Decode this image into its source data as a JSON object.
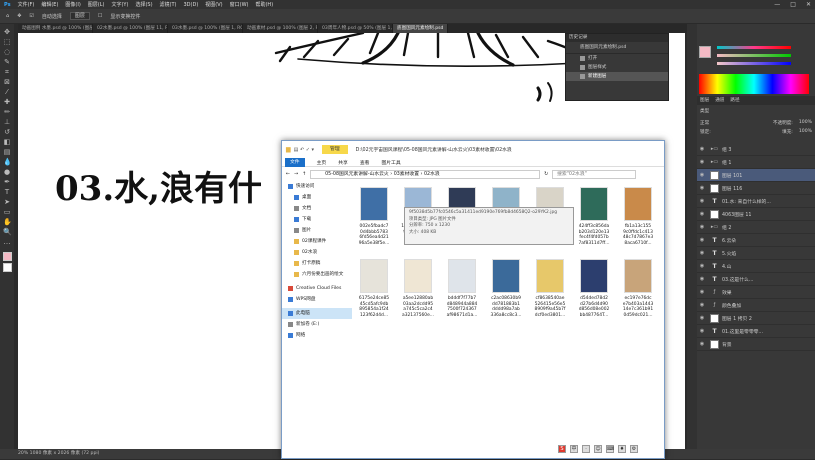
{
  "menubar": {
    "items": [
      "文件(F)",
      "编辑(E)",
      "图像(I)",
      "图层(L)",
      "文字(Y)",
      "选择(S)",
      "滤镜(T)",
      "3D(D)",
      "视图(V)",
      "窗口(W)",
      "帮助(H)"
    ],
    "window_controls": [
      "—",
      "□",
      "✕"
    ]
  },
  "options_bar": {
    "auto_select": "自动选择",
    "target": "图层",
    "show_transform": "显示变换控件"
  },
  "doc_tabs": [
    "动画图例 水墨.psd @ 100% (图层 1, RGB/8)",
    "02水墨.psd @ 100% (图层 11, RGB/8)",
    "03水墨.psd @ 100% (图层 1, RGB/8)",
    "动画素材.psd @ 100% (图层 2, RGB/8)",
    "03周年人物.psd @ 50% (图层 1, RGB/8)",
    "底图国风元素绘制.psd"
  ],
  "canvas": {
    "heading": "03.水,浪有什"
  },
  "status_bar": "20%   1080 像素 x 2026 像素 (72 ppi)",
  "history_panel": {
    "title": "历史记录",
    "snapshot": "底图国风元素绘制.psd",
    "rows": [
      "打开",
      "图层样式",
      "新建图层"
    ]
  },
  "layers_panel": {
    "tabs": [
      "图层",
      "通道",
      "路径"
    ],
    "kind": "类型",
    "blend": "正常",
    "opacity_label": "不透明度:",
    "opacity": "100%",
    "lock_label": "锁定:",
    "fill_label": "填充:",
    "fill": "100%",
    "rows": [
      {
        "type": "group",
        "name": "组 3"
      },
      {
        "type": "group",
        "name": "组 1"
      },
      {
        "type": "image",
        "name": "图层 101"
      },
      {
        "type": "image",
        "name": "图层 116"
      },
      {
        "type": "text",
        "name": "01.水: 来自什么样的..."
      },
      {
        "type": "image",
        "name": "4063图层 11"
      },
      {
        "type": "group",
        "name": "组 2"
      },
      {
        "type": "text",
        "name": "6.云朵"
      },
      {
        "type": "text",
        "name": "5.火焰"
      },
      {
        "type": "text",
        "name": "4.山"
      },
      {
        "type": "text",
        "name": "03.这是什么..."
      },
      {
        "type": "fx",
        "name": "效果"
      },
      {
        "type": "fx",
        "name": "颜色叠加"
      },
      {
        "type": "image",
        "name": "图层 1 拷贝 2"
      },
      {
        "type": "text",
        "name": "01.这里是零零零..."
      },
      {
        "type": "image",
        "name": "背景"
      }
    ]
  },
  "explorer": {
    "title": "D:\\02元宇宙国风课程\\05-08国风元素讲解-山水云火\\03素材收置\\02水浪",
    "manage_tab": "管理",
    "ribbon": [
      "文件",
      "主页",
      "共享",
      "查看",
      "图片工具"
    ],
    "breadcrumb": [
      "05-08国风元素讲解-山水云火",
      "03素材收置",
      "02水浪"
    ],
    "search_placeholder": "搜索\"02水浪\"",
    "nav": [
      {
        "label": "快速访问",
        "color": "#3a7bd5"
      },
      {
        "label": "桌面",
        "color": "#3a7bd5"
      },
      {
        "label": "文档",
        "color": "#888888"
      },
      {
        "label": "下载",
        "color": "#3a7bd5"
      },
      {
        "label": "图片",
        "color": "#888888"
      },
      {
        "label": "02课程课件",
        "color": "#e8b84a"
      },
      {
        "label": "02水浪",
        "color": "#e8b84a"
      },
      {
        "label": "打卡原稿",
        "color": "#e8b84a"
      },
      {
        "label": "六月份要出画的绘文",
        "color": "#e8b84a"
      },
      {
        "label": "Creative Cloud Files",
        "color": "#d94a3a"
      },
      {
        "label": "WPS网盘",
        "color": "#3a7bd5"
      },
      {
        "label": "此电脑",
        "color": "#3a7bd5"
      },
      {
        "label": "新加卷 (E:)",
        "color": "#888888"
      },
      {
        "label": "网络",
        "color": "#3a7bd5"
      }
    ],
    "files_row1": [
      {
        "name": "002e5fbadc7 0d4bbb5783 6fd56ea4d21 96a5e38f5e...",
        "color": "#3f6fa6"
      },
      {
        "name": "119d991b9e16 9fb86f4658...",
        "color": "#9bb7d6"
      },
      {
        "name": "fc56e4a8853 60b3091f6a...",
        "color": "#2f3b56"
      },
      {
        "name": "19127d2b9d 534a65191...",
        "color": "#8fb3c9"
      },
      {
        "name": "4a061138117a 0b19c0e8...",
        "color": "#d9d4c8"
      },
      {
        "name": "424ff3c856da b203d120e13 fec4f4fd057b 7af8311d7ff...",
        "color": "#2e6b5a"
      },
      {
        "name": "fb1a13c155 9c0ffdc1c413 48c7d7867e3 8aca6710f...",
        "color": "#c98a4a"
      }
    ],
    "files_row2": [
      {
        "name": "6175e24ce85 45cd5afc9db 895854a1f24 123f62d4d...",
        "color": "#e6e3da"
      },
      {
        "name": "a5ee12880ab 03aa2dcdd95 a745c5ca2c4 a32137560e...",
        "color": "#efe6d4"
      },
      {
        "name": "bdddf7f77b7 d848944a884 7500f724367 af98671d1a...",
        "color": "#dfe4ea"
      },
      {
        "name": "c2ac08630b9 dd781883b1 dddd98a7ab 336a8cc8c3...",
        "color": "#3b6a9a"
      },
      {
        "name": "cf8638540ae 526415e56e5 8909f9a45b7f dcf0ed3801...",
        "color": "#e7c86a"
      },
      {
        "name": "d54ded78d2 d27b6d4d90 d856d08e002 bb487764T...",
        "color": "#2c3e6e"
      },
      {
        "name": "ec197e76dc e7b403a1443 14e7c361b91 0d59dc021...",
        "color": "#c8a47a"
      }
    ],
    "tooltip": [
      "9f5038d5b77fc0546c5a31411ed9190e769fb8d4658Q2-o29YK2.jpg",
      "项目类型: JPG 图片文件",
      "分辨率: 750 x 1230",
      "大小: 408 KB"
    ]
  },
  "colors": {
    "ps_bg": "#2b2b2b",
    "accent": "#1a6fc9",
    "layer_selected": "#4a5a7a"
  }
}
